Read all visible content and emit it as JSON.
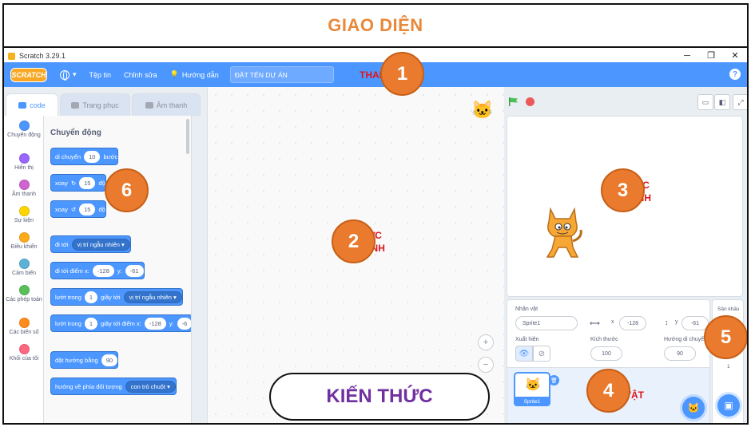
{
  "banner": {
    "title": "GIAO DIỆN"
  },
  "window": {
    "title": "Scratch 3.29.1",
    "minimize": "─",
    "maximize": "❐",
    "close": "✕"
  },
  "menubar": {
    "logo": "SCRATCH",
    "file": "Tệp tin",
    "edit": "Chỉnh sửa",
    "tutorials": "Hướng dẫn",
    "project_title_placeholder": "ĐẶT TÊN DỰ ÁN",
    "overlay_label": "THANH MENU",
    "help": "?"
  },
  "tabs": {
    "code": "code",
    "costumes": "Trang phục",
    "sounds": "Âm thanh"
  },
  "categories": [
    {
      "label": "Chuyển động",
      "color": "#4c97ff"
    },
    {
      "label": "Hiển thị",
      "color": "#9966ff"
    },
    {
      "label": "Âm thanh",
      "color": "#cf63cf"
    },
    {
      "label": "Sự kiện",
      "color": "#ffd500"
    },
    {
      "label": "Điều khiển",
      "color": "#ffab19"
    },
    {
      "label": "Cảm biến",
      "color": "#5cb1d6"
    },
    {
      "label": "Các phép toán",
      "color": "#59c059"
    },
    {
      "label": "Các biến số",
      "color": "#ff8c1a"
    },
    {
      "label": "Khối của tôi",
      "color": "#ff6680"
    }
  ],
  "palette": {
    "title": "Chuyển động",
    "move": {
      "a": "di chuyển",
      "v": "10",
      "b": "bước"
    },
    "turn_right": {
      "a": "xoay",
      "v": "15",
      "b": "độ"
    },
    "turn_left": {
      "a": "xoay",
      "v": "15",
      "b": "độ"
    },
    "goto": {
      "a": "đi tới",
      "opt": "vị trí ngẫu nhiên"
    },
    "goto_xy": {
      "a": "đi tới điểm x:",
      "x": "-128",
      "b": "y:",
      "y": "-61"
    },
    "glide": {
      "a": "lướt trong",
      "v": "1",
      "b": "giây tới",
      "opt": "vị trí ngẫu nhiên"
    },
    "glide_xy": {
      "a": "lướt trong",
      "v": "1",
      "b": "giây tới điểm x:",
      "x": "-128",
      "c": "y:",
      "y": "-6"
    },
    "point_dir": {
      "a": "đặt hướng bằng",
      "v": "90"
    },
    "point_towards": {
      "a": "hướng về phía đối tượng",
      "opt": "con trỏ chuột"
    }
  },
  "code_area": {
    "label_line1": "KHU VỰC",
    "label_line2": "LẬP TRÌNH",
    "zoom_in": "+",
    "zoom_out": "−"
  },
  "stage": {
    "label_line1": "KHU VỰC",
    "label_line2": "MÀN HÌNH"
  },
  "sprite_info": {
    "sprite_label": "Nhân vật",
    "sprite_name": "Sprite1",
    "x_label": "x",
    "x_value": "-128",
    "y_label": "y",
    "y_value": "-61",
    "show_label": "Xuất hiện",
    "size_label": "Kích thước",
    "size_value": "100",
    "direction_label": "Hướng di chuyển",
    "direction_value": "90"
  },
  "sprite_list": {
    "thumb_label": "Sprite1",
    "overlay_label": "NHÂN VẬT"
  },
  "stage_selector": {
    "label": "Sân khấu",
    "backdrops": "1"
  },
  "badges": [
    "1",
    "2",
    "3",
    "4",
    "5",
    "6"
  ],
  "callout": "KIẾN THỨC"
}
